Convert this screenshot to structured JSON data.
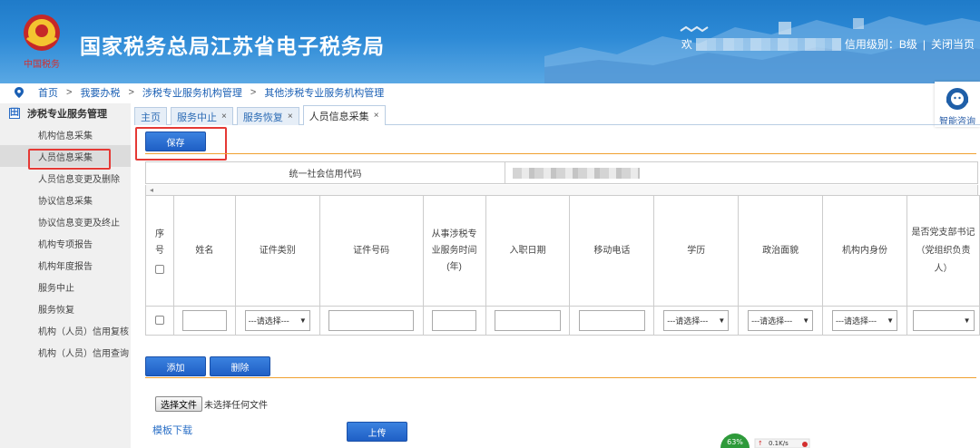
{
  "header": {
    "title": "国家税务总局江苏省电子税务局",
    "welcome": "欢",
    "credit_level": "信用级别：B级",
    "close_link": "关闭当页"
  },
  "breadcrumb": [
    "首页",
    "我要办税",
    "涉税专业服务机构管理",
    "其他涉税专业服务机构管理"
  ],
  "sidebar": {
    "section_title": "涉税专业服务管理",
    "items": [
      {
        "label": "机构信息采集",
        "active": false
      },
      {
        "label": "人员信息采集",
        "active": true
      },
      {
        "label": "人员信息变更及删除",
        "active": false
      },
      {
        "label": "协议信息采集",
        "active": false
      },
      {
        "label": "协议信息变更及终止",
        "active": false
      },
      {
        "label": "机构专项报告",
        "active": false
      },
      {
        "label": "机构年度报告",
        "active": false
      },
      {
        "label": "服务中止",
        "active": false
      },
      {
        "label": "服务恢复",
        "active": false
      },
      {
        "label": "机构（人员）信用复核",
        "active": false
      },
      {
        "label": "机构（人员）信用查询",
        "active": false
      }
    ]
  },
  "tabs": [
    {
      "label": "主页",
      "closable": false,
      "active": false
    },
    {
      "label": "服务中止",
      "closable": true,
      "active": false
    },
    {
      "label": "服务恢复",
      "closable": true,
      "active": false
    },
    {
      "label": "人员信息采集",
      "closable": true,
      "active": true
    }
  ],
  "help": {
    "label": "智能咨询"
  },
  "toolbar": {
    "save_label": "保存"
  },
  "credit_code": {
    "label": "统一社会信用代码"
  },
  "table": {
    "columns": {
      "seq": "序号",
      "name": "姓名",
      "id_type": "证件类别",
      "id_no": "证件号码",
      "years": "从事涉税专业服务时间(年)",
      "entry_date": "入职日期",
      "mobile": "移动电话",
      "education": "学历",
      "political": "政治面貌",
      "org_role": "机构内身份",
      "party_secretary": "是否党支部书记（党组织负责人）"
    },
    "select_placeholder": "---请选择---"
  },
  "actions": {
    "add_label": "添加",
    "delete_label": "删除"
  },
  "file": {
    "choose_label": "选择文件",
    "status": "未选择任何文件",
    "template_link": "模板下载",
    "upload_label": "上传"
  },
  "network": {
    "percent": "63%",
    "speed": "0.1K/s"
  },
  "colors": {
    "brand_blue": "#2d8ad6",
    "button_blue": "#2b6fd3",
    "accent_orange": "#f0a030",
    "highlight_red": "#e53935"
  }
}
